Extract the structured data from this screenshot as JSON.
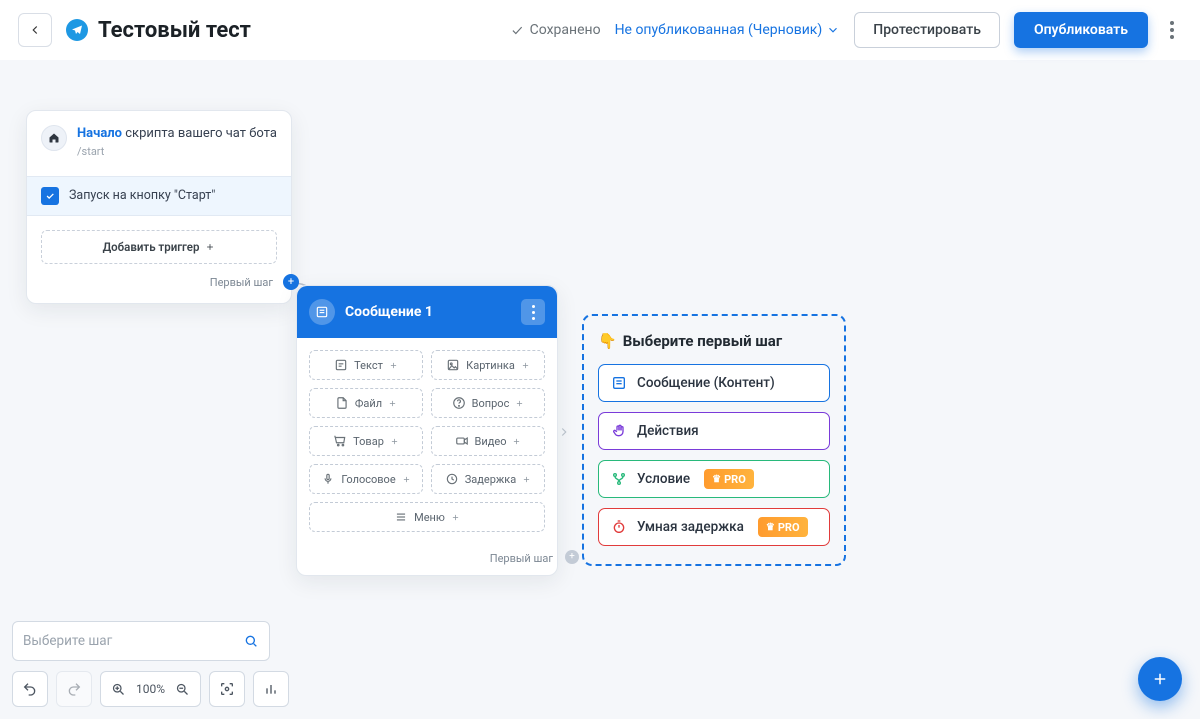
{
  "header": {
    "title": "Тестовый тест",
    "saved_label": "Сохранено",
    "publish_state": "Не опубликованная (Черновик)",
    "test_btn": "Протестировать",
    "publish_btn": "Опубликовать"
  },
  "start": {
    "title_strong": "Начало",
    "title_rest": "скрипта вашего чат бота",
    "subtitle": "/start",
    "trigger": "Запуск на кнопку \"Старт\"",
    "add_trigger": "Добавить триггер",
    "port_label": "Первый шаг"
  },
  "message": {
    "title": "Сообщение 1",
    "items": [
      {
        "label": "Текст"
      },
      {
        "label": "Картинка"
      },
      {
        "label": "Файл"
      },
      {
        "label": "Вопрос"
      },
      {
        "label": "Товар"
      },
      {
        "label": "Видео"
      },
      {
        "label": "Голосовое"
      },
      {
        "label": "Задержка"
      }
    ],
    "menu_label": "Меню",
    "port_label": "Первый шаг"
  },
  "picker": {
    "title": "Выберите первый шаг",
    "options": [
      {
        "label": "Сообщение (Контент)"
      },
      {
        "label": "Действия"
      },
      {
        "label": "Условие",
        "pro": true
      },
      {
        "label": "Умная задержка",
        "pro": true
      }
    ],
    "pro_badge": "PRO"
  },
  "search": {
    "placeholder": "Выберите шаг"
  },
  "toolbar": {
    "zoom": "100%"
  }
}
